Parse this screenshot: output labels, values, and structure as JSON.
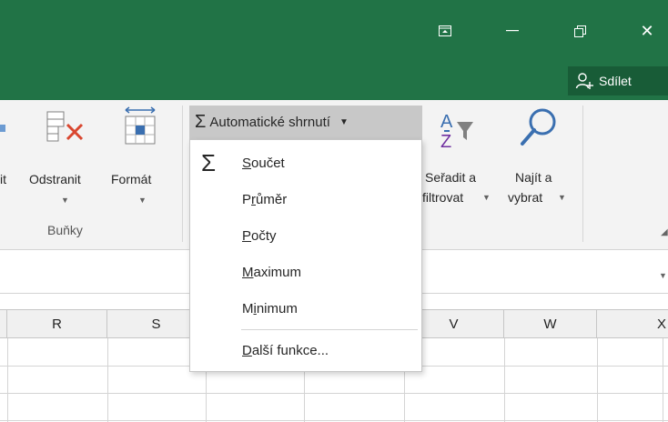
{
  "icons": {
    "ribbon_display": "ribbon-display-options-icon",
    "minimize": "minimize-icon",
    "restore": "restore-icon",
    "close": "close-icon",
    "share": "share-person-icon"
  },
  "titlebar": {
    "close_glyph": "✕"
  },
  "share": {
    "label": "Sdílet"
  },
  "ribbon": {
    "insert_partial": "it",
    "delete_label": "Odstranit",
    "format_label": "Formát",
    "cells_group_label": "Buňky",
    "sort_filter_line1": "Seřadit a",
    "sort_filter_line2": "filtrovat",
    "find_select_line1": "Najít a",
    "find_select_line2": "vybrat",
    "autosum_label": "Automatické shrnutí"
  },
  "menu": {
    "items": [
      {
        "pre": "",
        "u": "S",
        "post": "oučet"
      },
      {
        "pre": "P",
        "u": "r",
        "post": "ůměr"
      },
      {
        "pre": "",
        "u": "P",
        "post": "očty"
      },
      {
        "pre": "",
        "u": "M",
        "post": "aximum"
      },
      {
        "pre": "M",
        "u": "i",
        "post": "nimum"
      },
      {
        "pre": "",
        "u": "D",
        "post": "alší funkce..."
      }
    ]
  },
  "sheet": {
    "columns": [
      "R",
      "S",
      "V",
      "W",
      "X"
    ]
  },
  "colors": {
    "titlebar": "#217346",
    "share_button": "#185c37",
    "ribbon_bg": "#f3f3f3",
    "autosum_active": "#c8c8c8"
  }
}
